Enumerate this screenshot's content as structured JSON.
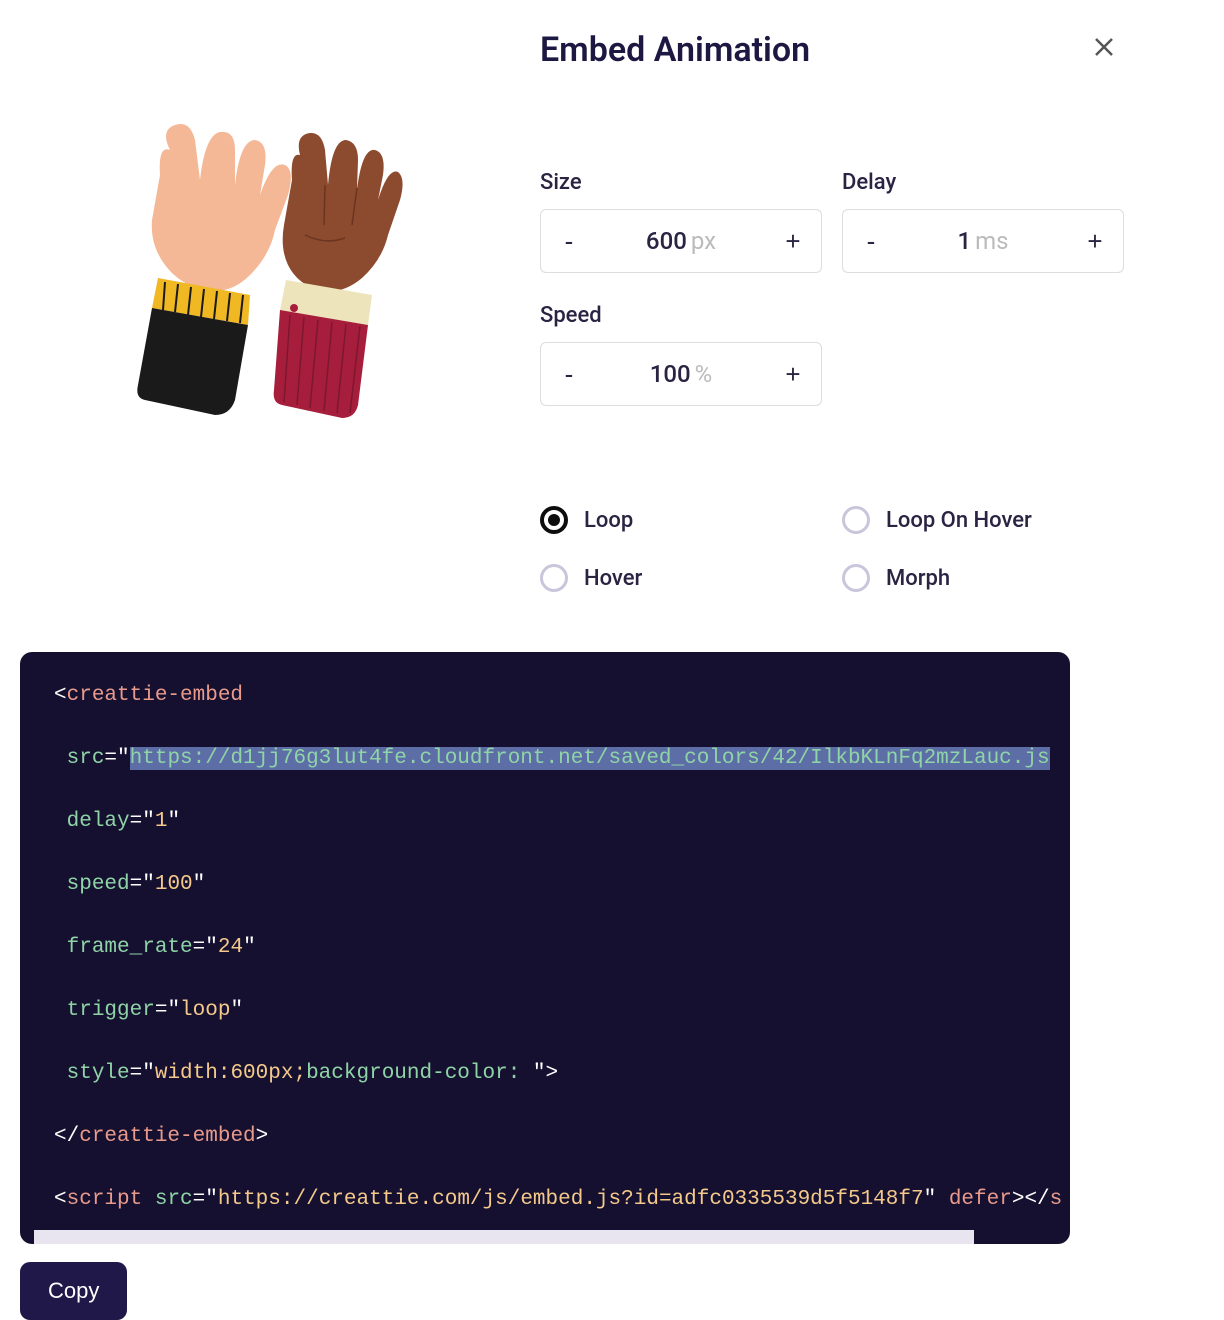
{
  "header": {
    "title": "Embed Animation"
  },
  "controls": {
    "size": {
      "label": "Size",
      "value": "600",
      "unit": "px"
    },
    "delay": {
      "label": "Delay",
      "value": "1",
      "unit": "ms"
    },
    "speed": {
      "label": "Speed",
      "value": "100",
      "unit": "%"
    }
  },
  "triggers": {
    "loop": "Loop",
    "loop_on_hover": "Loop On Hover",
    "hover": "Hover",
    "morph": "Morph",
    "selected": "loop"
  },
  "code": {
    "tag": "creattie-embed",
    "src_url": "https://d1jj76g3lut4fe.cloudfront.net/saved_colors/42/IlkbKLnFq2mzLauc.js",
    "delay": "1",
    "speed": "100",
    "frame_rate": "24",
    "trigger": "loop",
    "style_width": "width:600px;",
    "style_bg": "background-color: ",
    "script_src": "https://creattie.com/js/embed.js?id=adfc0335539d5f5148f7",
    "script_attr": "defer"
  },
  "buttons": {
    "copy": "Copy"
  }
}
